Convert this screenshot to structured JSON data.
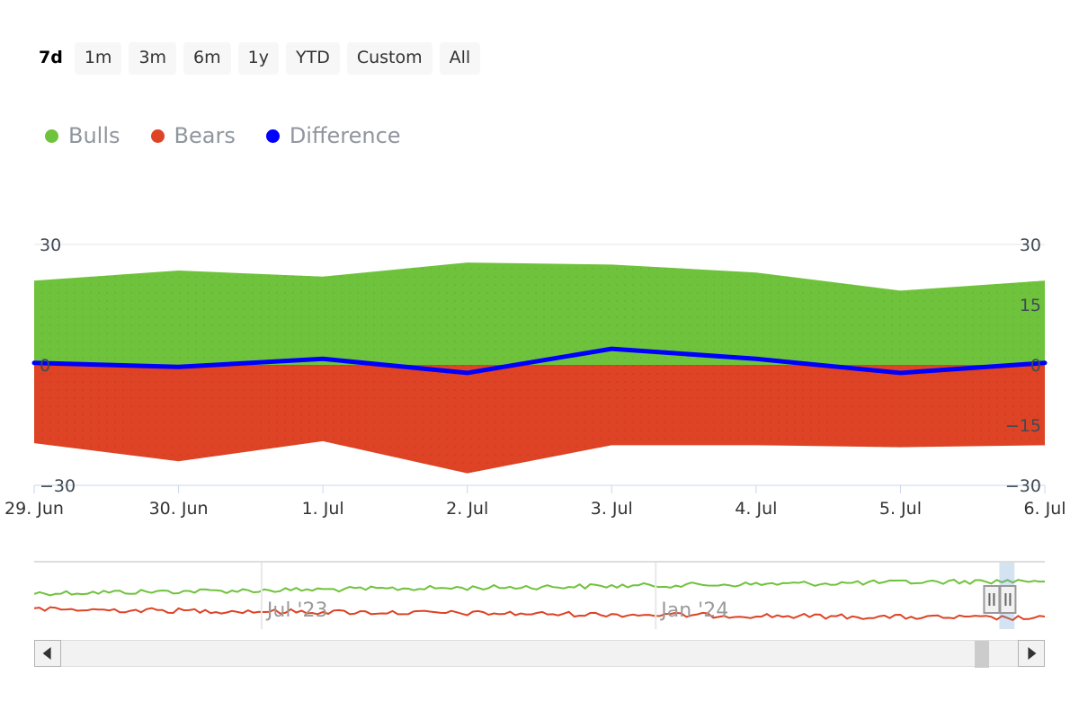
{
  "range_selector": {
    "buttons": [
      {
        "label": "7d",
        "selected": true
      },
      {
        "label": "1m",
        "selected": false
      },
      {
        "label": "3m",
        "selected": false
      },
      {
        "label": "6m",
        "selected": false
      },
      {
        "label": "1y",
        "selected": false
      },
      {
        "label": "YTD",
        "selected": false
      },
      {
        "label": "Custom",
        "selected": false
      },
      {
        "label": "All",
        "selected": false
      }
    ]
  },
  "legend": {
    "items": [
      {
        "label": "Bulls",
        "color": "#6fc23c"
      },
      {
        "label": "Bears",
        "color": "#dd4324"
      },
      {
        "label": "Difference",
        "color": "#0000ff"
      }
    ]
  },
  "navigator": {
    "date_labels": [
      {
        "text": "Jul '23",
        "x_pct": 22.5
      },
      {
        "text": "Jan '24",
        "x_pct": 61.5
      }
    ],
    "selection": {
      "start_pct": 95.5,
      "end_pct": 97.0
    },
    "series_colors": {
      "bulls": "#6fc23c",
      "bears": "#dd4324"
    },
    "scroll_left_icon": "triangle-left-icon",
    "scroll_right_icon": "triangle-right-icon"
  },
  "chart_data": {
    "type": "area",
    "title": "",
    "xlabel": "",
    "ylabel": "",
    "ylim": [
      -30,
      30
    ],
    "y_ticks_left": [
      30,
      0,
      -30
    ],
    "y_ticks_right": [
      30,
      15,
      0,
      -15,
      -30
    ],
    "grid": true,
    "legend_position": "top-left",
    "categories": [
      "29. Jun",
      "30. Jun",
      "1. Jul",
      "2. Jul",
      "3. Jul",
      "4. Jul",
      "5. Jul",
      "6. Jul"
    ],
    "series": [
      {
        "name": "Bulls",
        "color": "#6fc23c",
        "fill": true,
        "values": [
          21.0,
          23.5,
          22.0,
          25.5,
          25.0,
          23.0,
          18.5,
          21.0
        ]
      },
      {
        "name": "Bears",
        "color": "#dd4324",
        "fill": true,
        "values": [
          -19.5,
          -24.0,
          -19.0,
          -27.0,
          -20.0,
          -20.0,
          -20.5,
          -20.0
        ]
      },
      {
        "name": "Difference",
        "color": "#0000ff",
        "fill": false,
        "values": [
          0.5,
          -0.5,
          1.5,
          -2.0,
          4.0,
          1.5,
          -2.0,
          0.5
        ]
      }
    ]
  }
}
